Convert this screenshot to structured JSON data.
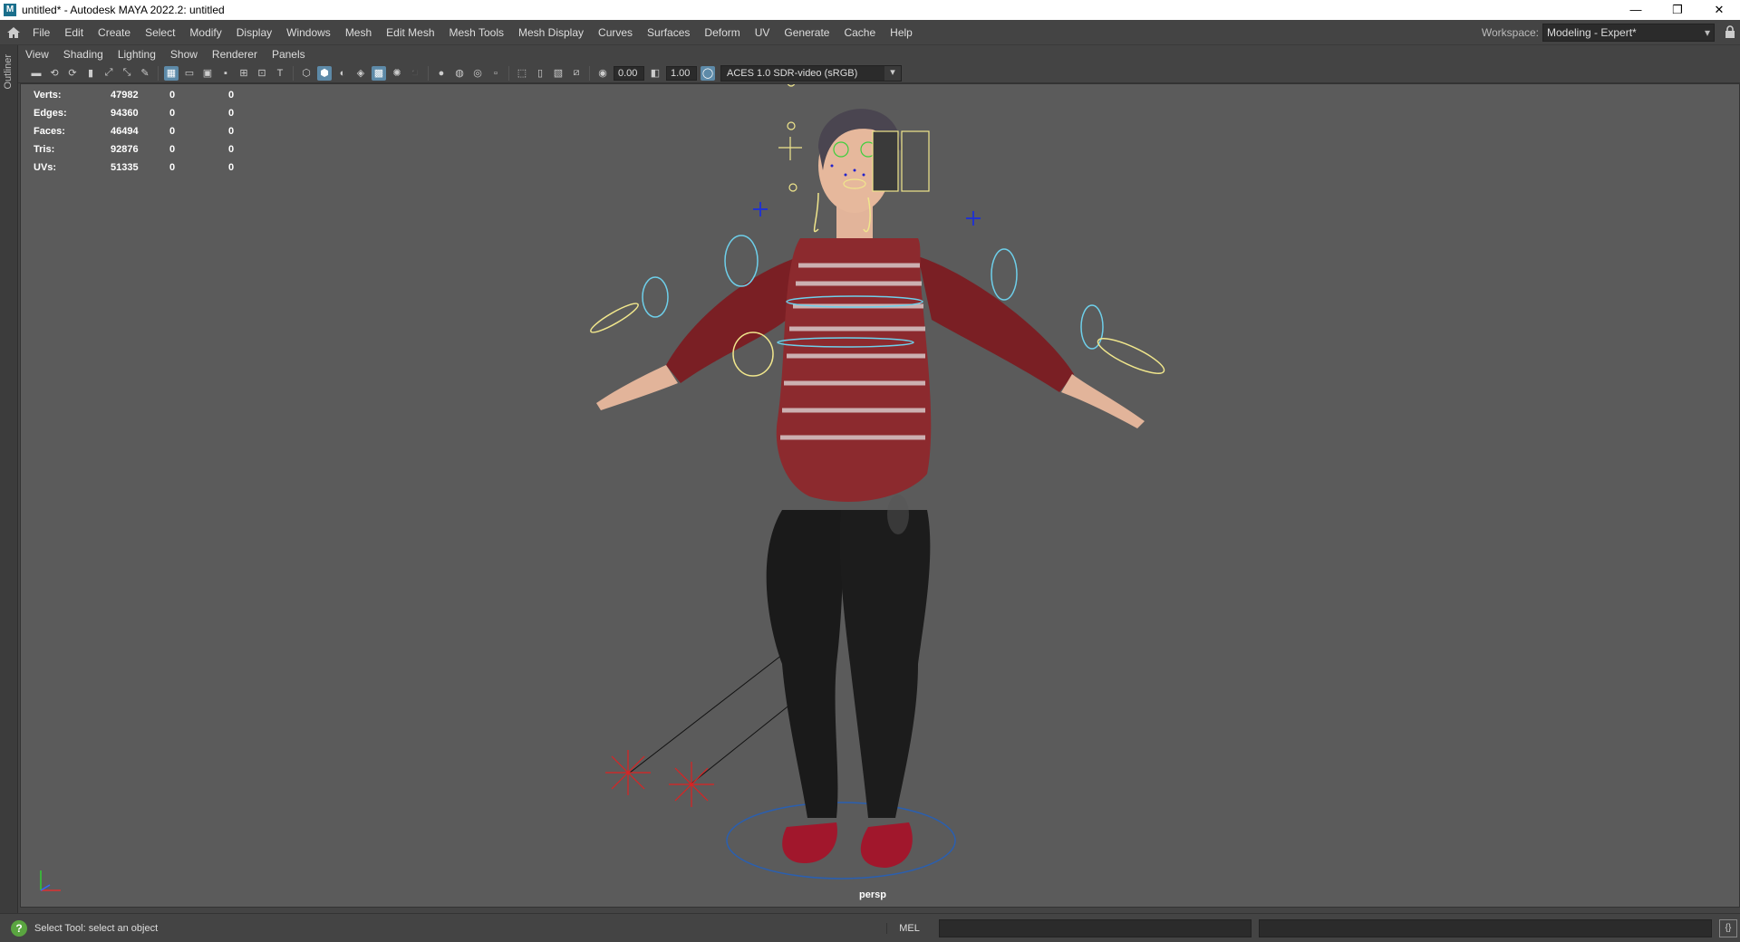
{
  "window": {
    "title": "untitled* - Autodesk MAYA 2022.2: untitled",
    "app_icon": "M",
    "buttons": {
      "minimize": "—",
      "restore": "❐",
      "close": "✕"
    }
  },
  "menubar": {
    "items": [
      "File",
      "Edit",
      "Create",
      "Select",
      "Modify",
      "Display",
      "Windows",
      "Mesh",
      "Edit Mesh",
      "Mesh Tools",
      "Mesh Display",
      "Curves",
      "Surfaces",
      "Deform",
      "UV",
      "Generate",
      "Cache",
      "Help"
    ],
    "workspace_label": "Workspace:",
    "workspace_value": "Modeling - Expert*"
  },
  "sidebar": {
    "outliner_label": "Outliner"
  },
  "panel_menu": {
    "items": [
      "View",
      "Shading",
      "Lighting",
      "Show",
      "Renderer",
      "Panels"
    ]
  },
  "panel_toolbar": {
    "exposure_value": "0.00",
    "gamma_value": "1.00",
    "color_space": "ACES 1.0 SDR-video (sRGB)"
  },
  "hud": {
    "rows": [
      {
        "label": "Verts:",
        "v1": "47982",
        "v2": "0",
        "v3": "0"
      },
      {
        "label": "Edges:",
        "v1": "94360",
        "v2": "0",
        "v3": "0"
      },
      {
        "label": "Faces:",
        "v1": "46494",
        "v2": "0",
        "v3": "0"
      },
      {
        "label": "Tris:",
        "v1": "92876",
        "v2": "0",
        "v3": "0"
      },
      {
        "label": "UVs:",
        "v1": "51335",
        "v2": "0",
        "v3": "0"
      }
    ]
  },
  "viewport": {
    "camera_label": "persp"
  },
  "statusbar": {
    "help_text": "Select Tool: select an object",
    "help_icon": "?",
    "command_language": "MEL"
  },
  "colors": {
    "viewport_bg": "#5b5b5b",
    "ui_bg": "#444444",
    "sweater_red": "#7a1f24",
    "control_yellow": "#f0e68c",
    "control_cyan": "#6ecfea"
  }
}
